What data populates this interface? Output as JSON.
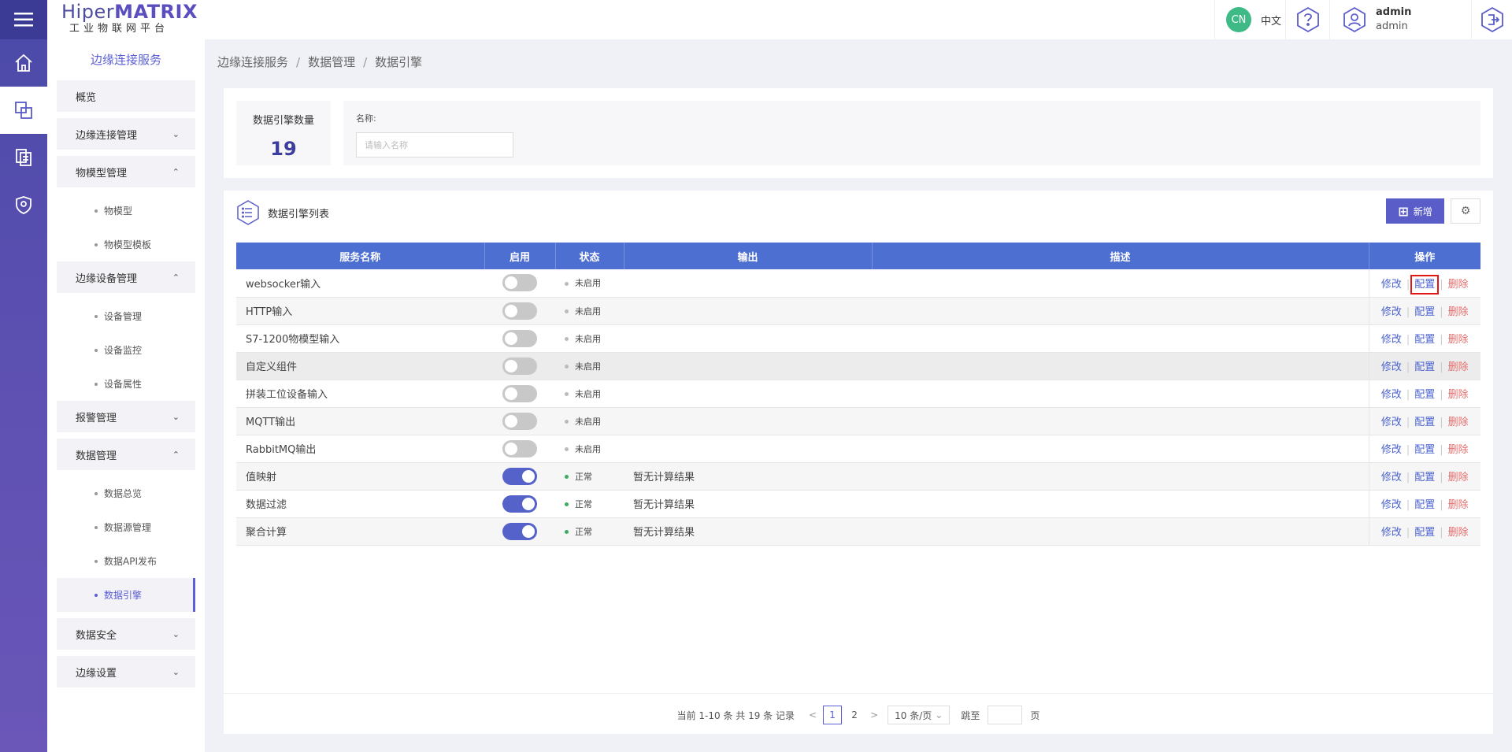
{
  "app": {
    "logo_line1_a": "Hiper",
    "logo_line1_b": "MATRIX",
    "logo_line2": "工业物联网平台"
  },
  "rail": {
    "icons": [
      "menu-icon",
      "home-icon",
      "edge-service-icon",
      "data-list-icon",
      "security-shield-icon"
    ]
  },
  "sidebar": {
    "title": "边缘连接服务",
    "items": [
      {
        "label": "概览",
        "type": "item"
      },
      {
        "label": "边缘连接管理",
        "type": "group",
        "chev": "⌄"
      },
      {
        "label": "物模型管理",
        "type": "group",
        "chev": "⌃"
      },
      {
        "label": "物模型",
        "type": "sub"
      },
      {
        "label": "物模型模板",
        "type": "sub"
      },
      {
        "label": "边缘设备管理",
        "type": "group",
        "chev": "⌃"
      },
      {
        "label": "设备管理",
        "type": "sub"
      },
      {
        "label": "设备监控",
        "type": "sub"
      },
      {
        "label": "设备属性",
        "type": "sub"
      },
      {
        "label": "报警管理",
        "type": "group",
        "chev": "⌄"
      },
      {
        "label": "数据管理",
        "type": "group",
        "chev": "⌃"
      },
      {
        "label": "数据总览",
        "type": "sub"
      },
      {
        "label": "数据源管理",
        "type": "sub"
      },
      {
        "label": "数据API发布",
        "type": "sub"
      },
      {
        "label": "数据引擎",
        "type": "sub-active"
      },
      {
        "label": "数据安全",
        "type": "group",
        "chev": "⌄"
      },
      {
        "label": "边缘设置",
        "type": "group",
        "chev": "⌄"
      }
    ]
  },
  "header": {
    "lang_badge": "CN",
    "lang_label": "中文",
    "user_name": "admin",
    "user_role": "admin"
  },
  "breadcrumb": [
    "边缘连接服务",
    "数据管理",
    "数据引擎"
  ],
  "summary": {
    "count_label": "数据引擎数量",
    "count_value": "19",
    "name_label": "名称:",
    "name_placeholder": "请输入名称"
  },
  "list": {
    "title": "数据引擎列表",
    "new_button": "新增",
    "columns": [
      "服务名称",
      "启用",
      "状态",
      "输出",
      "描述",
      "操作"
    ],
    "rows": [
      {
        "name": "websocker输入",
        "enabled": false,
        "status": "未启用",
        "output": "",
        "desc": ""
      },
      {
        "name": "HTTP输入",
        "enabled": false,
        "status": "未启用",
        "output": "",
        "desc": ""
      },
      {
        "name": "S7-1200物模型输入",
        "enabled": false,
        "status": "未启用",
        "output": "",
        "desc": ""
      },
      {
        "name": "自定义组件",
        "enabled": false,
        "status": "未启用",
        "output": "",
        "desc": ""
      },
      {
        "name": "拼装工位设备输入",
        "enabled": false,
        "status": "未启用",
        "output": "",
        "desc": ""
      },
      {
        "name": "MQTT输出",
        "enabled": false,
        "status": "未启用",
        "output": "",
        "desc": ""
      },
      {
        "name": "RabbitMQ输出",
        "enabled": false,
        "status": "未启用",
        "output": "",
        "desc": ""
      },
      {
        "name": "值映射",
        "enabled": true,
        "status": "正常",
        "output": "暂无计算结果",
        "desc": ""
      },
      {
        "name": "数据过滤",
        "enabled": true,
        "status": "正常",
        "output": "暂无计算结果",
        "desc": ""
      },
      {
        "name": "聚合计算",
        "enabled": true,
        "status": "正常",
        "output": "暂无计算结果",
        "desc": ""
      }
    ],
    "ops": {
      "edit": "修改",
      "config": "配置",
      "delete": "删除"
    }
  },
  "pager": {
    "summary": "当前 1-10 条 共 19 条 记录",
    "prev": "<",
    "pages": [
      "1",
      "2"
    ],
    "next": ">",
    "page_size": "10 条/页",
    "jump_label": "跳至",
    "page_suffix": "页"
  },
  "colors": {
    "accent": "#5a5cc8",
    "table_header": "#4d6fd1",
    "danger": "#e86c6c",
    "ok": "#3bab5f"
  }
}
